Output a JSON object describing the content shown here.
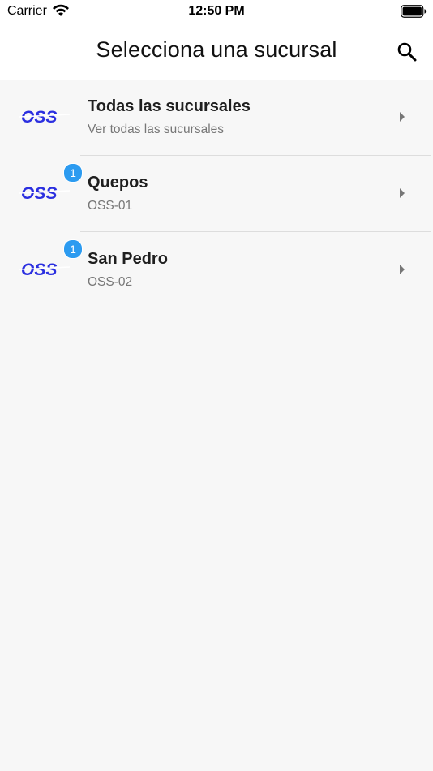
{
  "status_bar": {
    "carrier": "Carrier",
    "time": "12:50 PM",
    "icons": [
      "wifi-icon",
      "battery-icon"
    ]
  },
  "header": {
    "title": "Selecciona una sucursal",
    "search_icon": "search-icon"
  },
  "colors": {
    "accent": "#2c9bf0",
    "logo_blue": "#2b2fe0",
    "background": "#f7f7f7"
  },
  "branches": [
    {
      "title": "Todas las sucursales",
      "subtitle": "Ver todas las sucursales",
      "badge": "",
      "logo": "OSS"
    },
    {
      "title": "Quepos",
      "subtitle": "OSS-01",
      "badge": "1",
      "logo": "OSS"
    },
    {
      "title": "San Pedro",
      "subtitle": "OSS-02",
      "badge": "1",
      "logo": "OSS"
    }
  ]
}
